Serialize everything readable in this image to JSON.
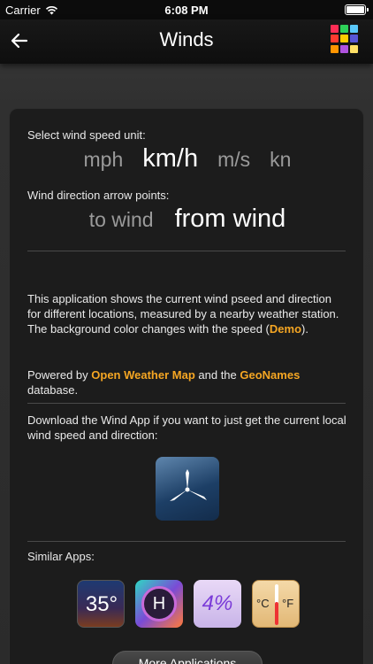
{
  "status_bar": {
    "carrier": "Carrier",
    "time": "6:08 PM"
  },
  "nav": {
    "title": "Winds",
    "grid_colors": [
      "#ff2d55",
      "#2ed158",
      "#5ac8fa",
      "#ff3b30",
      "#ffcc00",
      "#5856d6",
      "#ff9500",
      "#af52de",
      "#ffe066"
    ]
  },
  "speed_unit": {
    "label": "Select wind speed unit:",
    "options": [
      "mph",
      "km/h",
      "m/s",
      "kn"
    ],
    "selected": "km/h"
  },
  "direction": {
    "label": "Wind direction arrow points:",
    "options": [
      "to wind",
      "from wind"
    ],
    "selected": "from wind"
  },
  "about": {
    "p1_a": "This application shows the current wind pseed and direction for different locations, measured by a nearby weather station. The background color changes with the speed (",
    "p1_link": "Demo",
    "p1_b": ").",
    "p2_a": "Powered by ",
    "p2_link1": "Open Weather Map",
    "p2_b": " and the ",
    "p2_link2": "GeoNames",
    "p2_c": " database.",
    "p3": "Download the Wind App if you want to just get the current local wind speed and direction:"
  },
  "similar": {
    "label": "Similar Apps:",
    "apps": [
      {
        "icon": "temperature-app-icon",
        "text": "35°"
      },
      {
        "icon": "humidity-app-icon",
        "text": "H"
      },
      {
        "icon": "percent-app-icon",
        "text": "4%"
      },
      {
        "icon": "thermometer-app-icon",
        "text_c": "°C",
        "text_f": "°F"
      }
    ]
  },
  "more_button": "More Applications",
  "colors": {
    "accent_link": "#f5a623"
  }
}
